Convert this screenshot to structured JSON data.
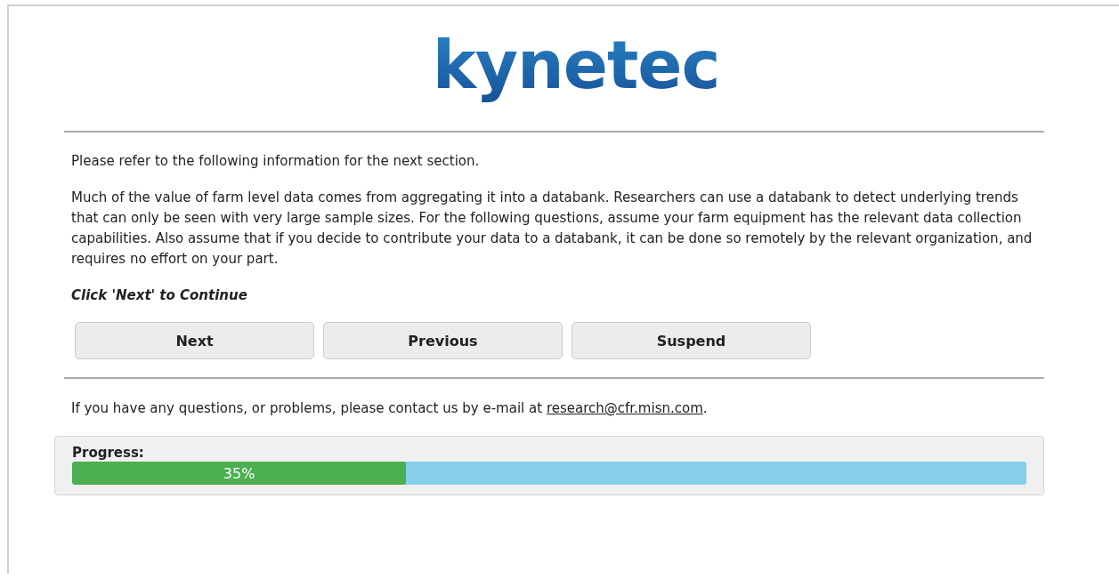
{
  "logo": {
    "text": "kynetec"
  },
  "intro": "Please refer to the following information for the next section.",
  "body": "Much of the value of farm level data comes from aggregating it into a databank. Researchers can use a databank to detect underlying trends that can only be seen with very large sample sizes. For the following questions, assume your farm equipment has the relevant data collection capabilities. Also assume that if you decide to contribute your data to a databank, it can be done so remotely by the relevant organization, and requires no effort on your part.",
  "instruction": "Click 'Next' to Continue",
  "buttons": [
    "Next",
    "Previous",
    "Suspend"
  ],
  "contact": {
    "text": "If you have any questions, or problems, please contact us by e-mail at",
    "email": "research@cfr.misn.com",
    "end": "."
  },
  "progress": {
    "label": "Progress:",
    "level": 0.35,
    "reading": "35%"
  }
}
